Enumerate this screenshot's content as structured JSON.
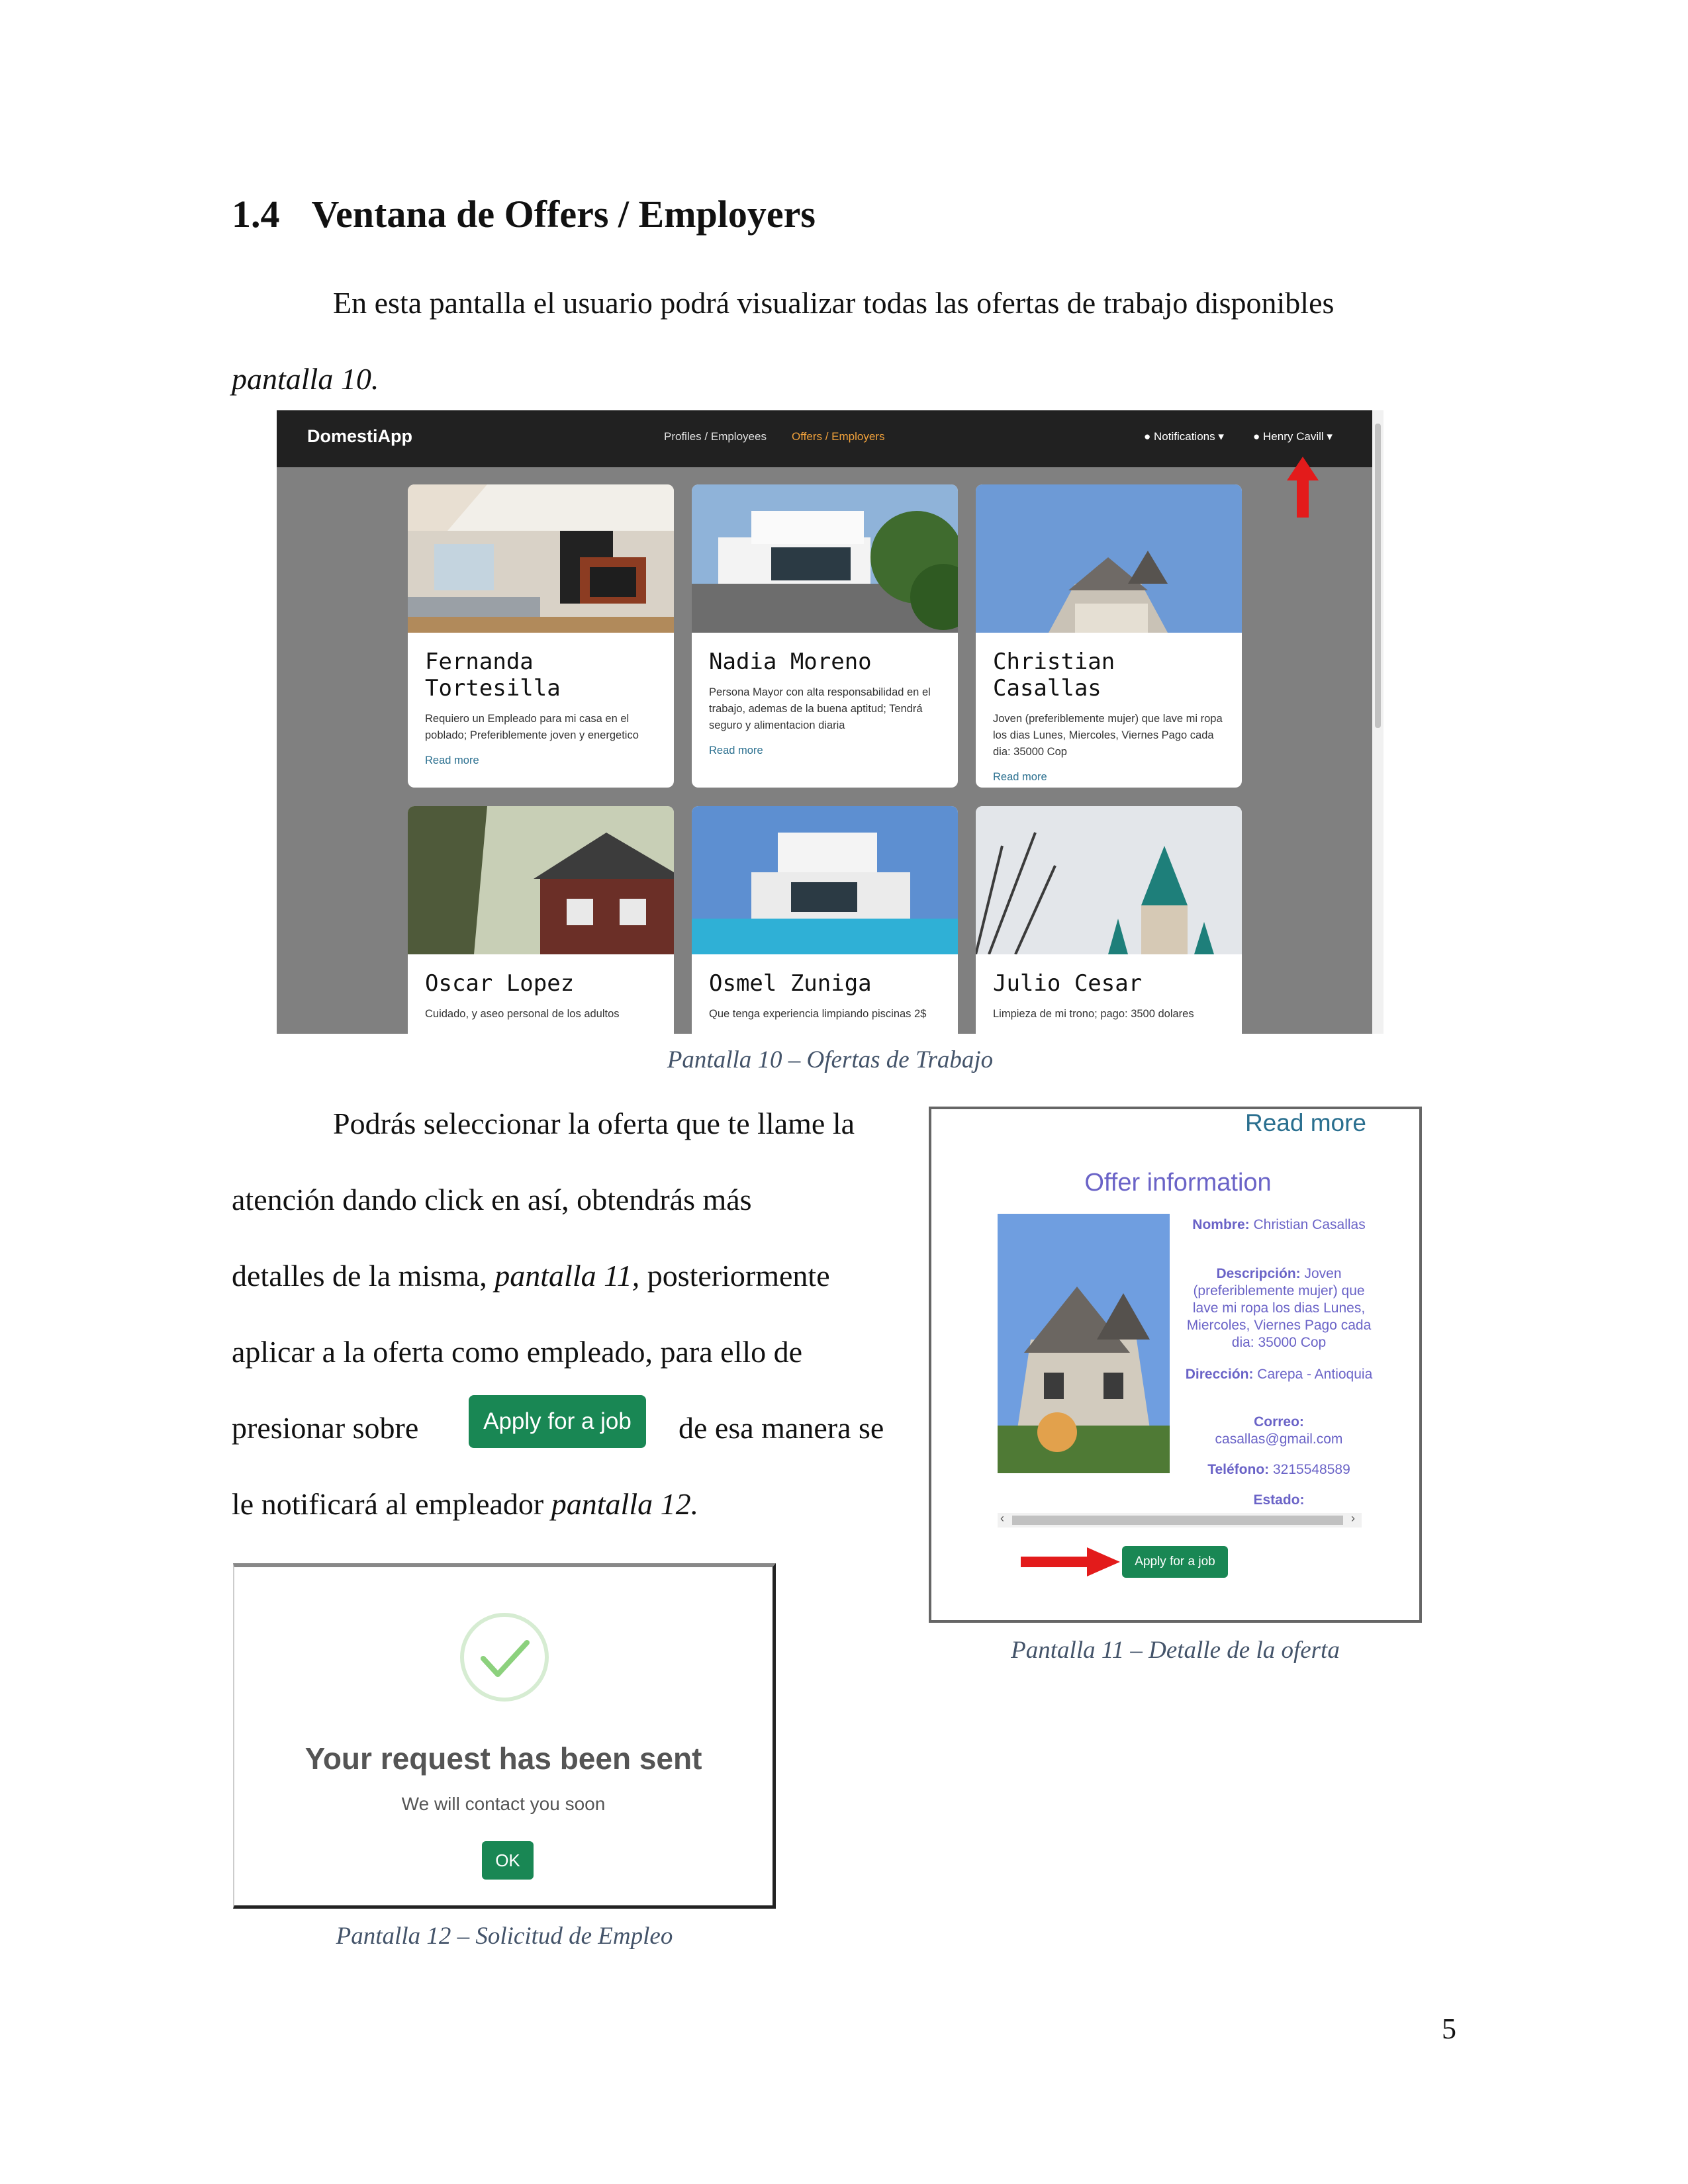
{
  "section": {
    "number": "1.4",
    "title": "Ventana de Offers / Employers"
  },
  "intro": {
    "line1": "En esta pantalla el usuario podrá visualizar todas las ofertas de trabajo disponibles",
    "line2": "pantalla 10."
  },
  "screen10": {
    "brand": "DomestiApp",
    "nav": {
      "profiles": "Profiles / Employees",
      "offers": "Offers / Employers",
      "notifications": "Notifications",
      "user": "Henry Cavill"
    },
    "cards": [
      {
        "name": "Fernanda Tortesilla",
        "desc": "Requiero un Empleado para mi casa en el poblado; Preferiblemente joven y energetico",
        "more": "Read more"
      },
      {
        "name": "Nadia Moreno",
        "desc": "Persona Mayor con alta responsabilidad en el trabajo, ademas de la buena aptitud; Tendrá seguro y alimentacion diaria",
        "more": "Read more"
      },
      {
        "name": "Christian Casallas",
        "desc": "Joven (preferiblemente mujer) que lave mi ropa los dias Lunes, Miercoles, Viernes Pago cada dia: 35000 Cop",
        "more": "Read more"
      },
      {
        "name": "Oscar Lopez",
        "desc": "Cuidado, y aseo personal de los adultos"
      },
      {
        "name": "Osmel Zuniga",
        "desc": "Que tenga experiencia limpiando piscinas 2$"
      },
      {
        "name": "Julio Cesar",
        "desc": "Limpieza de mi trono; pago: 3500 dolares"
      }
    ],
    "caption": "Pantalla 10 – Ofertas de Trabajo"
  },
  "body": {
    "l1": "Podrás seleccionar la oferta que te llame la",
    "l2": "atención dando click en así, obtendrás más",
    "l3a": "detalles de la misma,",
    "l3b": "pantalla 11,",
    "l3c": "posteriormente",
    "l4": "aplicar a la oferta como empleado, para ello de",
    "l5a": "presionar sobre",
    "l5b": "de esa manera se",
    "l6a": "le notificará al empleador",
    "l6b": "pantalla 12.",
    "button": "Apply for a job"
  },
  "screen11": {
    "readmore": "Read more",
    "title": "Offer information",
    "fields": [
      {
        "label": "Nombre:",
        "value": "Christian Casallas"
      },
      {
        "label": "Descripción:",
        "value": "Joven (preferiblemente mujer) que lave mi ropa los dias Lunes, Miercoles, Viernes Pago cada dia: 35000 Cop"
      },
      {
        "label": "Dirección:",
        "value": "Carepa - Antioquia"
      },
      {
        "label": "Correo:",
        "value": "casallas@gmail.com"
      },
      {
        "label": "Teléfono:",
        "value": "3215548589"
      },
      {
        "label": "Estado:",
        "value": ""
      }
    ],
    "button": "Apply for a job",
    "caption": "Pantalla 11 – Detalle de la oferta"
  },
  "screen12": {
    "title": "Your request has been sent",
    "subtitle": "We will contact you soon",
    "ok": "OK",
    "caption": "Pantalla 12 – Solicitud de Empleo"
  },
  "page_number": "5",
  "colors": {
    "navbar": "#212121",
    "active": "#f0a13b",
    "green": "#198754",
    "purple": "#6a63c7",
    "arrow": "#e31b1b"
  }
}
